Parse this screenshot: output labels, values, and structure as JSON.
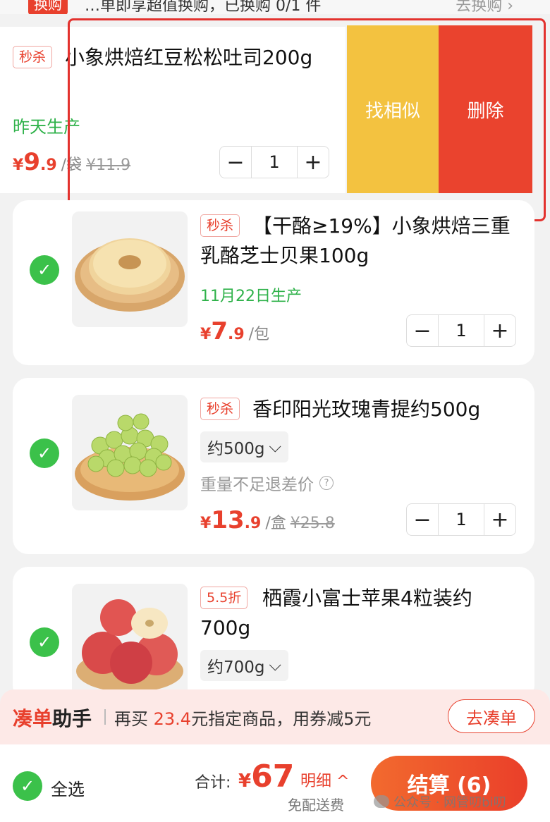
{
  "top_strip": {
    "tag": "换购",
    "text": "…单即享超值换购，已换购 0/1 件",
    "link": "去换购 ›"
  },
  "swiped_item": {
    "tag": "秒杀",
    "name": "小象烘焙红豆松松吐司200g",
    "date": "昨天生产",
    "price_currency": "¥",
    "price_int": "9",
    "price_dec": ".9",
    "unit": "/袋",
    "orig_price": "¥11.9",
    "qty": "1",
    "action_similar": "找相似",
    "action_delete": "删除"
  },
  "items": [
    {
      "tag": "秒杀",
      "title": "【干酪≥19%】小象烘焙三重乳酪芝士贝果100g",
      "date": "11月22日生产",
      "price_currency": "¥",
      "price_int": "7",
      "price_dec": ".9",
      "unit": "/包",
      "qty": "1",
      "image": "bagel-image"
    },
    {
      "tag": "秒杀",
      "title": "香印阳光玫瑰青提约500g",
      "spec": "约500g",
      "note": "重量不足退差价",
      "price_currency": "¥",
      "price_int": "13",
      "price_dec": ".9",
      "unit": "/盒",
      "orig_price": "¥25.8",
      "qty": "1",
      "image": "grapes-image"
    },
    {
      "tag": "5.5折",
      "title": "栖霞小富士苹果4粒装约700g",
      "spec": "约700g",
      "image": "apples-image"
    }
  ],
  "helper": {
    "brand_a": "凑单",
    "brand_b": "助手",
    "msg_prefix": "再买",
    "amount": "23.4",
    "msg_suffix": "元指定商品，用券减5元",
    "button": "去凑单"
  },
  "checkout": {
    "select_all": "全选",
    "total_label": "合计:",
    "total_currency": "¥",
    "total_value": "67",
    "detail": "明细 ^",
    "shipping": "免配送费",
    "pay_button": "结算 (6)"
  },
  "watermark": "公众号 · 网管叨bi叨",
  "colors": {
    "accent": "#e8402d",
    "green": "#3bc14a",
    "similar": "#f3c240",
    "delete": "#ea432e"
  }
}
